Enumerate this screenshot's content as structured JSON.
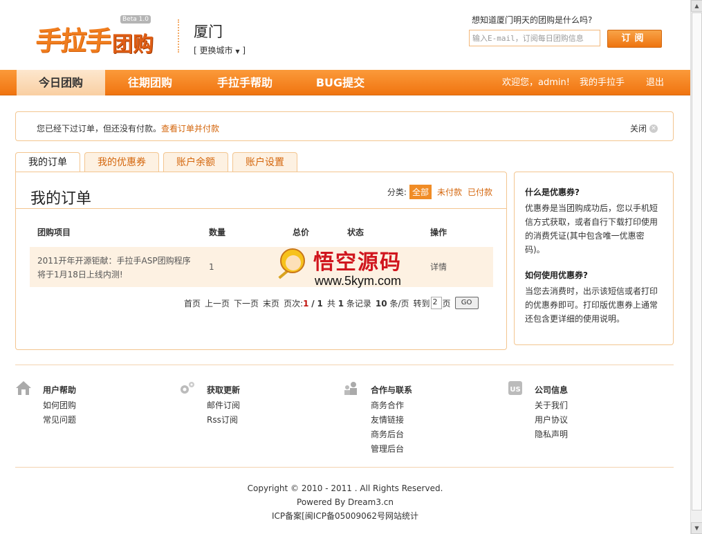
{
  "header": {
    "logo_main": "手拉手",
    "logo_sub": "团购",
    "logo_beta": "Beta 1.0",
    "city": "厦门",
    "city_switch": "[ 更换城市",
    "city_switch_end": "]",
    "subscribe_question": "想知道厦门明天的团购是什么吗?",
    "subscribe_placeholder": "输入E-mail，订阅每日团购信息",
    "subscribe_button": "订阅"
  },
  "nav": {
    "items": [
      {
        "label": "今日团购",
        "active": true
      },
      {
        "label": "往期团购",
        "active": false
      },
      {
        "label": "手拉手帮助",
        "active": false
      },
      {
        "label": "BUG提交",
        "active": false
      }
    ],
    "welcome": "欢迎您，",
    "username": "admin!",
    "my_account": "我的手拉手",
    "logout": "退出"
  },
  "notice": {
    "text": "您已经下过订单，但还没有付款。",
    "link": "查看订单并付款",
    "close": "关闭"
  },
  "tabs": [
    {
      "label": "我的订单",
      "active": true
    },
    {
      "label": "我的优惠券",
      "active": false
    },
    {
      "label": "账户余额",
      "active": false
    },
    {
      "label": "账户设置",
      "active": false
    }
  ],
  "orders": {
    "title": "我的订单",
    "filter_label": "分类:",
    "filter_all": "全部",
    "filter_unpaid": "未付款",
    "filter_paid": "已付款",
    "columns": [
      "团购项目",
      "数量",
      "总价",
      "状态",
      "操作"
    ],
    "rows": [
      {
        "name": "2011开年开源钜献：手拉手ASP团购程序将于1月18日上线内测!",
        "quantity": "1",
        "total": "",
        "status": "",
        "action": "详情"
      }
    ],
    "pager": {
      "first": "首页",
      "prev": "上一页",
      "next": "下一页",
      "last": "末页",
      "page_label": "页次:",
      "current": "1",
      "sep": "/",
      "total_pages": "1",
      "total_label": "共",
      "records": "1",
      "records_label": "条记录",
      "per_page": "10",
      "per_page_label": "条/页",
      "goto_label": "转到",
      "goto_value": "2",
      "page_suffix": "页",
      "go": "GO"
    }
  },
  "watermark": {
    "cn": "悟空源码",
    "url": "www.5kym.com"
  },
  "sidebar": {
    "q1": "什么是优惠券?",
    "a1": "优惠券是当团购成功后，您以手机短信方式获取，或者自行下载打印使用的消费凭证(其中包含唯一优惠密码)。",
    "q2": "如何使用优惠券?",
    "a2": "当您去消费时，出示该短信或者打印的优惠券即可。打印版优惠券上通常还包含更详细的使用说明。"
  },
  "footer": {
    "cols": [
      {
        "icon": "home-icon",
        "title": "用户帮助",
        "links": [
          "如何团购",
          "常见问题"
        ]
      },
      {
        "icon": "gears-icon",
        "title": "获取更新",
        "links": [
          "邮件订阅",
          "Rss订阅"
        ]
      },
      {
        "icon": "people-icon",
        "title": "合作与联系",
        "links": [
          "商务合作",
          "友情链接",
          "商务后台",
          "管理后台"
        ]
      },
      {
        "icon": "us-icon",
        "title": "公司信息",
        "links": [
          "关于我们",
          "用户协议",
          "隐私声明"
        ]
      }
    ],
    "copyright": "Copyright © 2010 - 2011 . All Rights Reserved.",
    "powered": "Powered By Dream3.cn",
    "icp": "ICP备案[闽ICP备05009062号网站统计"
  },
  "colors": {
    "accent": "#f07d1e",
    "link": "#d4660c",
    "border": "#f3c58f"
  }
}
